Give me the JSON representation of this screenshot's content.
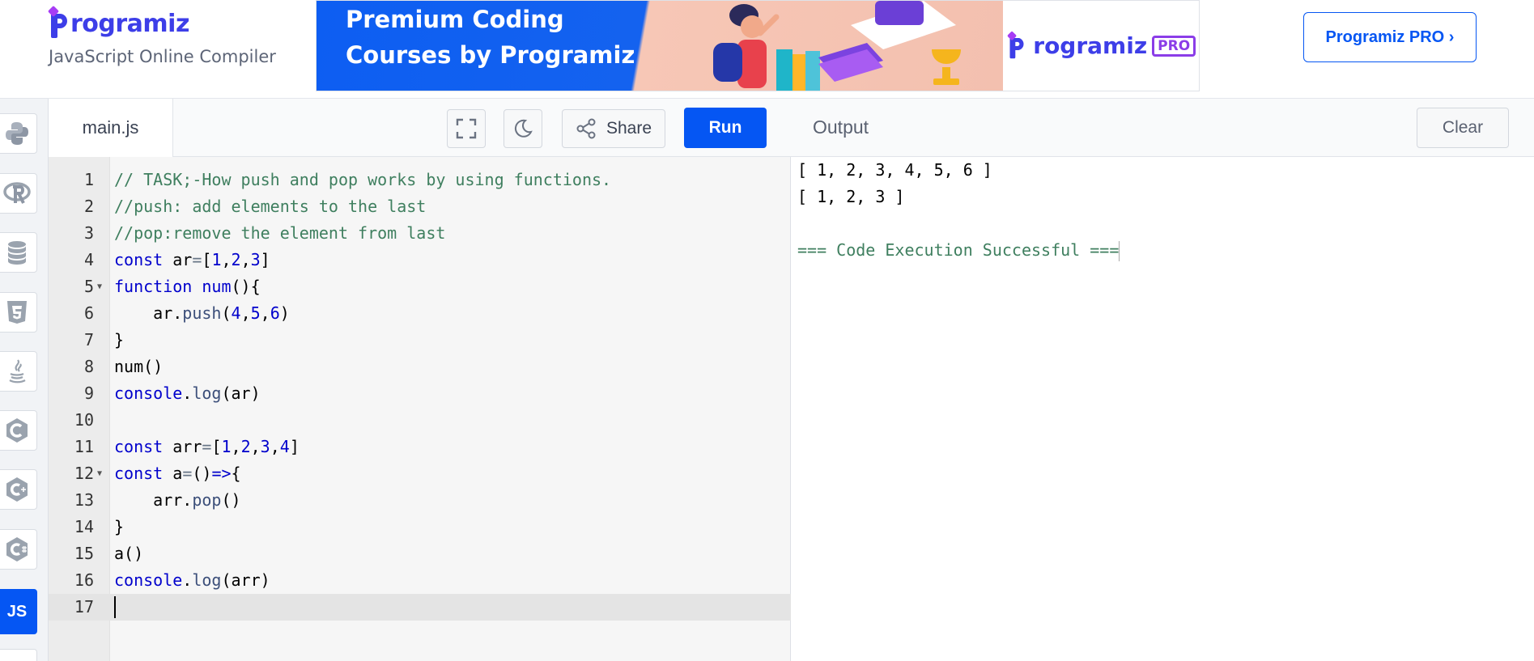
{
  "header": {
    "logo_text": "rogramiz",
    "subtitle": "JavaScript Online Compiler",
    "banner": {
      "line1": "Premium Coding",
      "line2": "Courses by Programiz",
      "pro_logo_text": "rogramiz",
      "pro_badge": "PRO"
    },
    "pro_button": "Programiz PRO ›"
  },
  "sidebar": {
    "languages": [
      {
        "name": "python",
        "icon": "python-icon"
      },
      {
        "name": "r",
        "icon": "r-icon"
      },
      {
        "name": "sql",
        "icon": "database-icon"
      },
      {
        "name": "html",
        "icon": "html5-icon"
      },
      {
        "name": "java",
        "icon": "java-icon"
      },
      {
        "name": "c",
        "icon": "c-icon"
      },
      {
        "name": "cpp",
        "icon": "cpp-icon"
      },
      {
        "name": "csharp",
        "icon": "csharp-icon"
      },
      {
        "name": "javascript",
        "label": "JS",
        "active": true
      }
    ]
  },
  "editor": {
    "filename": "main.js",
    "share_label": "Share",
    "run_label": "Run",
    "current_line": 17,
    "lines": [
      {
        "n": "1",
        "fold": false,
        "tokens": [
          [
            "cm",
            "// TASK;-How push and pop works by using functions."
          ]
        ]
      },
      {
        "n": "2",
        "fold": false,
        "tokens": [
          [
            "cm",
            "//push: add elements to the last"
          ]
        ]
      },
      {
        "n": "3",
        "fold": false,
        "tokens": [
          [
            "cm",
            "//pop:remove the element from last"
          ]
        ]
      },
      {
        "n": "4",
        "fold": false,
        "tokens": [
          [
            "kw",
            "const"
          ],
          [
            "id",
            " ar"
          ],
          [
            "op",
            "="
          ],
          [
            "id",
            "["
          ],
          [
            "num",
            "1"
          ],
          [
            "id",
            ","
          ],
          [
            "num",
            "2"
          ],
          [
            "id",
            ","
          ],
          [
            "num",
            "3"
          ],
          [
            "id",
            "]"
          ]
        ]
      },
      {
        "n": "5",
        "fold": true,
        "tokens": [
          [
            "kw",
            "function"
          ],
          [
            "id",
            " "
          ],
          [
            "kw",
            "num"
          ],
          [
            "id",
            "(){"
          ]
        ]
      },
      {
        "n": "6",
        "fold": false,
        "tokens": [
          [
            "id",
            "    ar."
          ],
          [
            "fn",
            "push"
          ],
          [
            "id",
            "("
          ],
          [
            "num",
            "4"
          ],
          [
            "id",
            ","
          ],
          [
            "num",
            "5"
          ],
          [
            "id",
            ","
          ],
          [
            "num",
            "6"
          ],
          [
            "id",
            ")"
          ]
        ]
      },
      {
        "n": "7",
        "fold": false,
        "tokens": [
          [
            "id",
            "}"
          ]
        ]
      },
      {
        "n": "8",
        "fold": false,
        "tokens": [
          [
            "id",
            "num()"
          ]
        ]
      },
      {
        "n": "9",
        "fold": false,
        "tokens": [
          [
            "kw",
            "console"
          ],
          [
            "id",
            "."
          ],
          [
            "fn",
            "log"
          ],
          [
            "id",
            "(ar)"
          ]
        ]
      },
      {
        "n": "10",
        "fold": false,
        "tokens": []
      },
      {
        "n": "11",
        "fold": false,
        "tokens": [
          [
            "kw",
            "const"
          ],
          [
            "id",
            " arr"
          ],
          [
            "op",
            "="
          ],
          [
            "id",
            "["
          ],
          [
            "num",
            "1"
          ],
          [
            "id",
            ","
          ],
          [
            "num",
            "2"
          ],
          [
            "id",
            ","
          ],
          [
            "num",
            "3"
          ],
          [
            "id",
            ","
          ],
          [
            "num",
            "4"
          ],
          [
            "id",
            "]"
          ]
        ]
      },
      {
        "n": "12",
        "fold": true,
        "tokens": [
          [
            "kw",
            "const"
          ],
          [
            "id",
            " a"
          ],
          [
            "op",
            "="
          ],
          [
            "id",
            "()"
          ],
          [
            "kw",
            "=>"
          ],
          [
            "id",
            "{"
          ]
        ]
      },
      {
        "n": "13",
        "fold": false,
        "tokens": [
          [
            "id",
            "    arr."
          ],
          [
            "fn",
            "pop"
          ],
          [
            "id",
            "()"
          ]
        ]
      },
      {
        "n": "14",
        "fold": false,
        "tokens": [
          [
            "id",
            "}"
          ]
        ]
      },
      {
        "n": "15",
        "fold": false,
        "tokens": [
          [
            "id",
            "a()"
          ]
        ]
      },
      {
        "n": "16",
        "fold": false,
        "tokens": [
          [
            "kw",
            "console"
          ],
          [
            "id",
            "."
          ],
          [
            "fn",
            "log"
          ],
          [
            "id",
            "(arr)"
          ]
        ]
      },
      {
        "n": "17",
        "fold": false,
        "tokens": []
      }
    ]
  },
  "output": {
    "title": "Output",
    "clear_label": "Clear",
    "lines": [
      "[ 1, 2, 3, 4, 5, 6 ]",
      "[ 1, 2, 3 ]",
      "",
      "=== Code Execution Successful ==="
    ]
  },
  "colors": {
    "accent": "#0556f3",
    "brand": "#3d3ee8",
    "comment": "#3f7f5f",
    "keyword": "#0000cc"
  }
}
